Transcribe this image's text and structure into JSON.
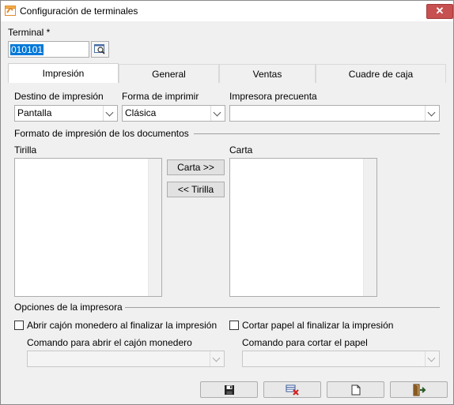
{
  "window": {
    "title": "Configuración de terminales",
    "close_label": "✕"
  },
  "terminal": {
    "label": "Terminal *",
    "value": "010101"
  },
  "tabs": [
    {
      "label": "Impresión",
      "active": true
    },
    {
      "label": "General",
      "active": false
    },
    {
      "label": "Ventas",
      "active": false
    },
    {
      "label": "Cuadre de caja",
      "active": false
    }
  ],
  "impresion": {
    "destino_label": "Destino de impresión",
    "destino_value": "Pantalla",
    "forma_label": "Forma de imprimir",
    "forma_value": "Clásica",
    "impresora_label": "Impresora precuenta",
    "impresora_value": "",
    "formato_section": "Formato de impresión de los documentos",
    "tirilla_label": "Tirilla",
    "carta_label": "Carta",
    "to_carta_button": "Carta >>",
    "to_tirilla_button": "<< Tirilla",
    "opciones_section": "Opciones de la impresora",
    "abrir_cajon_label": "Abrir cajón monedero al finalizar la impresión",
    "abrir_cajon_checked": false,
    "cortar_papel_label": "Cortar papel al finalizar la impresión",
    "cortar_papel_checked": false,
    "comando_cajon_label": "Comando para abrir el cajón monedero",
    "comando_cajon_value": "",
    "comando_cortar_label": "Comando para cortar el papel",
    "comando_cortar_value": ""
  },
  "footer": {
    "icons": [
      "save-icon",
      "cancel-icon",
      "new-icon",
      "exit-icon"
    ]
  }
}
